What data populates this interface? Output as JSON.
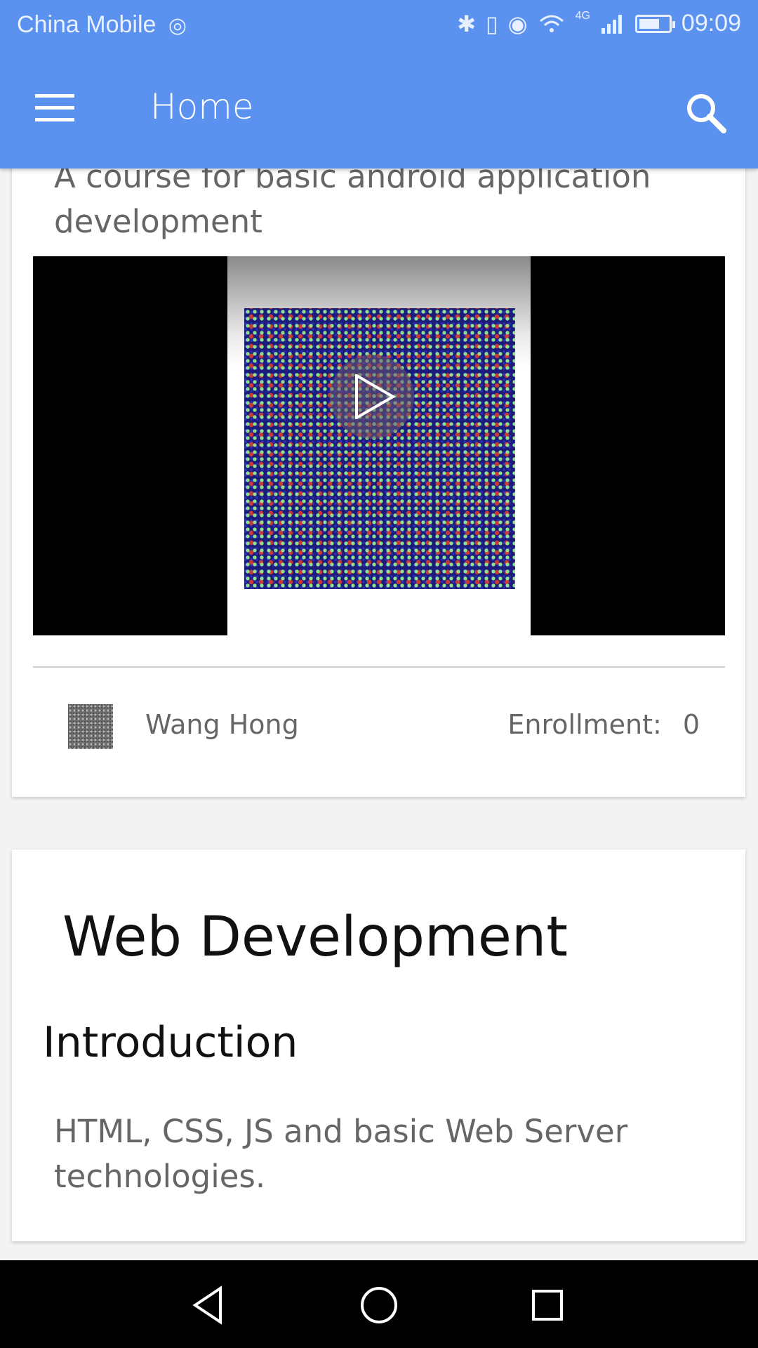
{
  "status_bar": {
    "carrier": "China Mobile",
    "network": "4G",
    "time": "09:09"
  },
  "toolbar": {
    "title": "Home",
    "menu_icon": "hamburger-menu-icon",
    "search_icon": "search-icon"
  },
  "courses": [
    {
      "description": "A course for basic android application development",
      "author": "Wang Hong",
      "enrollment_label": "Enrollment:",
      "enrollment_count": "0"
    },
    {
      "title": "Web Development",
      "subtitle": "Introduction",
      "description": "HTML, CSS, JS and basic Web Server technologies."
    }
  ],
  "colors": {
    "app_bar": "#5b92f0",
    "background": "#f3f3f3",
    "card": "#ffffff",
    "muted_text": "#666666"
  }
}
